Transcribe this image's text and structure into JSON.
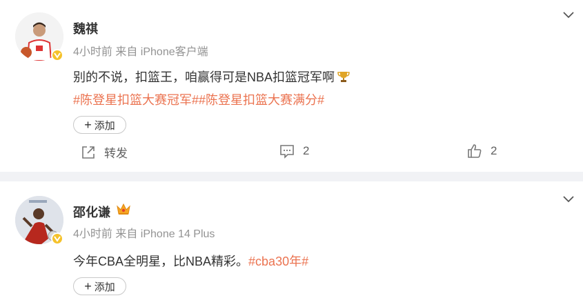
{
  "posts": [
    {
      "author": "魏祺",
      "meta": "4小时前  来自 iPhone客户端",
      "text": "别的不说，扣篮王，咱赢得可是NBA扣篮冠军啊",
      "hashtags": "#陈登星扣篮大赛冠军##陈登星扣篮大赛满分#",
      "add_label": "添加",
      "actions": {
        "repost_label": "转发",
        "comment_count": "2",
        "like_count": "2"
      }
    },
    {
      "author": "邵化谦",
      "meta": "4小时前  来自 iPhone 14 Plus",
      "text": "今年CBA全明星，比NBA精彩。",
      "hashtag": "#cba30年#",
      "add_label": "添加"
    }
  ],
  "colors": {
    "accent_orange": "#eb7350",
    "verified_gold": "#f5c22b",
    "separator": "#f1f2f5"
  },
  "icons": [
    "chevron-down-icon",
    "verified-badge-icon",
    "trophy-icon",
    "crown-icon",
    "repost-icon",
    "comment-icon",
    "like-icon"
  ]
}
